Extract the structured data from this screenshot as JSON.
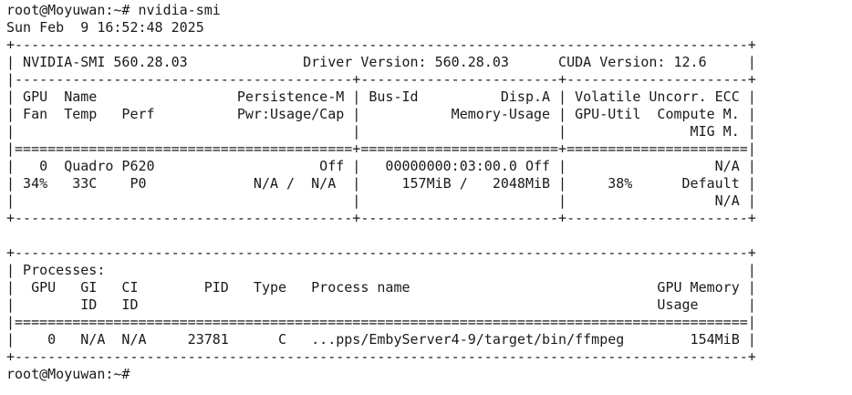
{
  "terminal": {
    "lines": [
      "root@Moyuwan:~# nvidia-smi",
      "Sun Feb  9 16:52:48 2025",
      "+-----------------------------------------------------------------------------------------+",
      "| NVIDIA-SMI 560.28.03              Driver Version: 560.28.03      CUDA Version: 12.6     |",
      "|-----------------------------------------+------------------------+----------------------+",
      "| GPU  Name                 Persistence-M | Bus-Id          Disp.A | Volatile Uncorr. ECC |",
      "| Fan  Temp   Perf          Pwr:Usage/Cap |           Memory-Usage | GPU-Util  Compute M. |",
      "|                                         |                        |               MIG M. |",
      "|=========================================+========================+======================|",
      "|   0  Quadro P620                    Off |   00000000:03:00.0 Off |                  N/A |",
      "| 34%   33C    P0             N/A /  N/A  |     157MiB /   2048MiB |     38%      Default |",
      "|                                         |                        |                  N/A |",
      "+-----------------------------------------+------------------------+----------------------+",
      "",
      "+-----------------------------------------------------------------------------------------+",
      "| Processes:                                                                              |",
      "|  GPU   GI   CI        PID   Type   Process name                              GPU Memory |",
      "|        ID   ID                                                               Usage      |",
      "|=========================================================================================|",
      "|    0   N/A  N/A     23781      C   ...pps/EmbyServer4-9/target/bin/ffmpeg        154MiB |",
      "+-----------------------------------------------------------------------------------------+",
      "root@Moyuwan:~#"
    ]
  }
}
